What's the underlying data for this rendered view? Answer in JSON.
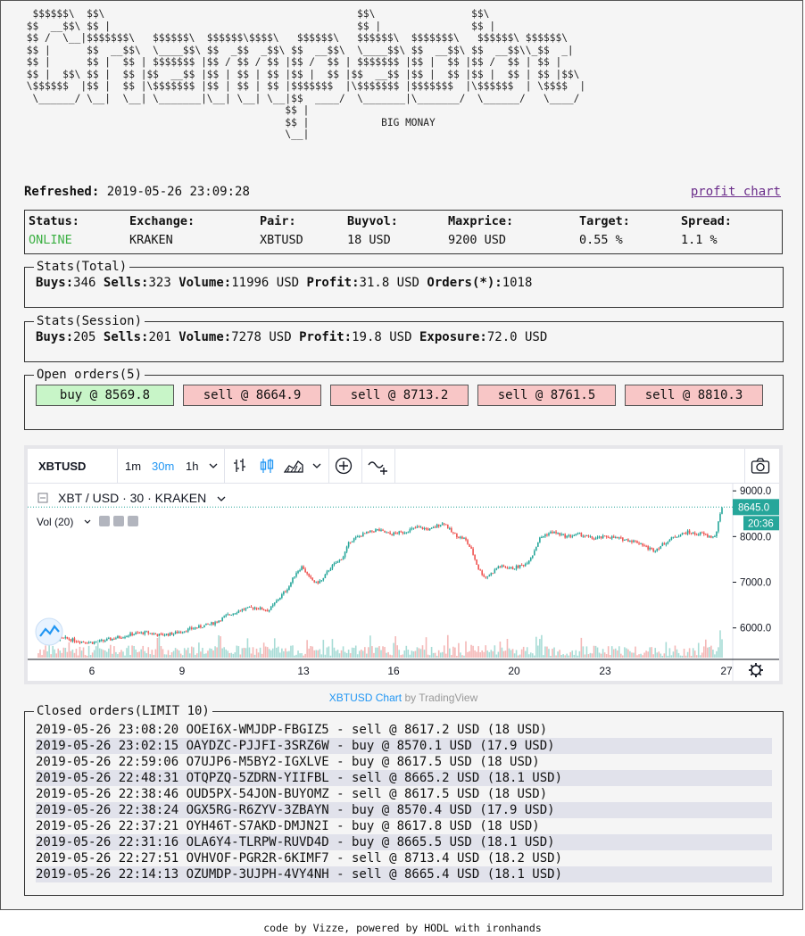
{
  "ascii_logo": "  $$$$$$\\  $$\\                                          $$\\                $$\\\n $$  __$$\\ $$ |                                         $$ |               $$ |\n $$ /  \\__|$$$$$$$\\   $$$$$$\\  $$$$$$\\$$$$\\   $$$$$$\\   $$$$$$\\  $$$$$$$\\   $$$$$$\\ $$$$$$\\\n $$ |      $$  __$$\\  \\____$$\\ $$  _$$  _$$\\ $$  __$$\\  \\____$$\\ $$  __$$\\ $$  __$$\\\\_$$  _|\n $$ |      $$ |  $$ | $$$$$$$ |$$ / $$ / $$ |$$ /  $$ | $$$$$$$ |$$ |  $$ |$$ /  $$ | $$ |\n $$ |  $$\\ $$ |  $$ |$$  __$$ |$$ | $$ | $$ |$$ |  $$ |$$  __$$ |$$ |  $$ |$$ |  $$ | $$ |$$\\\n \\$$$$$$  |$$ |  $$ |\\$$$$$$$ |$$ | $$ | $$ |$$$$$$$  |\\$$$$$$$ |$$$$$$$  |\\$$$$$$  | \\$$$$  |\n  \\______/ \\__|  \\__| \\_______|\\__| \\__| \\__|$$  ____/  \\_______|\\_______/  \\______/   \\____/\n                                            $$ |\n                                            $$ |            BIG MONAY\n                                            \\__|",
  "refreshed": {
    "label": "Refreshed:",
    "value": "2019-05-26 23:09:28"
  },
  "profit_chart_link": "profit chart",
  "status": {
    "columns": [
      {
        "label": "Status:",
        "value": "ONLINE"
      },
      {
        "label": "Exchange:",
        "value": "KRAKEN"
      },
      {
        "label": "Pair:",
        "value": "XBTUSD"
      },
      {
        "label": "Buyvol:",
        "value": "18 USD"
      },
      {
        "label": "Maxprice:",
        "value": "9200 USD"
      },
      {
        "label": "Target:",
        "value": "0.55 %"
      },
      {
        "label": "Spread:",
        "value": "1.1 %"
      }
    ]
  },
  "stats_total": {
    "legend": "Stats(Total)",
    "buys_label": "Buys:",
    "buys": "346",
    "sells_label": "Sells:",
    "sells": "323",
    "volume_label": "Volume:",
    "volume": "11996 USD",
    "profit_label": "Profit:",
    "profit": "31.8 USD",
    "orders_label": "Orders(*):",
    "orders": "1018"
  },
  "stats_session": {
    "legend": "Stats(Session)",
    "buys_label": "Buys:",
    "buys": "205",
    "sells_label": "Sells:",
    "sells": "201",
    "volume_label": "Volume:",
    "volume": "7278 USD",
    "profit_label": "Profit:",
    "profit": "19.8 USD",
    "exposure_label": "Exposure:",
    "exposure": "72.0 USD"
  },
  "open_orders": {
    "legend": "Open orders(5)",
    "items": [
      {
        "side": "buy",
        "label": "buy @ 8569.8"
      },
      {
        "side": "sell",
        "label": "sell @ 8664.9"
      },
      {
        "side": "sell",
        "label": "sell @ 8713.2"
      },
      {
        "side": "sell",
        "label": "sell @ 8761.5"
      },
      {
        "side": "sell",
        "label": "sell @ 8810.3"
      }
    ]
  },
  "tradingview": {
    "symbol": "XBTUSD",
    "timeframes": [
      "1m",
      "30m",
      "1h"
    ],
    "active_timeframe": "30m",
    "legend_pair": "XBT / USD",
    "legend_interval": "30",
    "legend_exchange": "KRAKEN",
    "volume_label": "Vol (20)",
    "price_tag": "8645.0",
    "countdown": "20:36",
    "accent_color": "#26a69a",
    "down_color": "#ef5350",
    "icons": [
      "candles-icon",
      "chevron-down-icon",
      "bars-icon",
      "candlestick-icon",
      "area-icon",
      "add-indicator-icon",
      "compare-icon",
      "camera-icon",
      "settings-icon",
      "tradingview-logo-icon"
    ]
  },
  "chart_data": {
    "type": "candlestick",
    "series": [
      {
        "name": "XBT / USD · 30 · KRAKEN"
      }
    ],
    "x_ticks": [
      "6",
      "9",
      "13",
      "16",
      "20",
      "23",
      "27"
    ],
    "y_ticks": [
      "6000.0",
      "7000.0",
      "8000.0",
      "9000.0"
    ],
    "ylim": [
      5350,
      9100
    ],
    "close_points": [
      [
        0,
        5760
      ],
      [
        2,
        5740
      ],
      [
        4,
        5770
      ],
      [
        6,
        5710
      ],
      [
        8,
        5680
      ],
      [
        10,
        5730
      ],
      [
        12,
        5800
      ],
      [
        14,
        5870
      ],
      [
        16,
        5900
      ],
      [
        18,
        5840
      ],
      [
        20,
        5880
      ],
      [
        22,
        5960
      ],
      [
        24,
        6030
      ],
      [
        26,
        6110
      ],
      [
        28,
        6280
      ],
      [
        30,
        6400
      ],
      [
        32,
        6450
      ],
      [
        34,
        6380
      ],
      [
        35,
        6550
      ],
      [
        37,
        6900
      ],
      [
        38,
        7200
      ],
      [
        39,
        7350
      ],
      [
        40,
        7100
      ],
      [
        41,
        6980
      ],
      [
        42,
        7050
      ],
      [
        43,
        7300
      ],
      [
        45,
        7550
      ],
      [
        46,
        7900
      ],
      [
        48,
        8050
      ],
      [
        50,
        8150
      ],
      [
        52,
        8050
      ],
      [
        54,
        8100
      ],
      [
        56,
        8200
      ],
      [
        58,
        8150
      ],
      [
        59,
        8250
      ],
      [
        60,
        8300
      ],
      [
        61,
        8100
      ],
      [
        62,
        8000
      ],
      [
        63,
        7950
      ],
      [
        64,
        7700
      ],
      [
        65,
        7300
      ],
      [
        66,
        7100
      ],
      [
        67,
        7200
      ],
      [
        68,
        7350
      ],
      [
        70,
        7300
      ],
      [
        72,
        7400
      ],
      [
        73,
        7600
      ],
      [
        74,
        7950
      ],
      [
        75,
        8050
      ],
      [
        76,
        8100
      ],
      [
        78,
        8000
      ],
      [
        80,
        8050
      ],
      [
        82,
        7950
      ],
      [
        84,
        8000
      ],
      [
        86,
        7950
      ],
      [
        88,
        7900
      ],
      [
        89,
        7850
      ],
      [
        90,
        7750
      ],
      [
        91,
        7700
      ],
      [
        92,
        7800
      ],
      [
        93,
        7900
      ],
      [
        94,
        8000
      ],
      [
        95,
        8050
      ],
      [
        96,
        8100
      ],
      [
        97,
        8050
      ],
      [
        98,
        8070
      ],
      [
        99,
        8000
      ],
      [
        100,
        7990
      ],
      [
        101,
        8650
      ]
    ]
  },
  "chart_caption": {
    "link": "XBTUSD Chart",
    "by": "by TradingView"
  },
  "closed_orders": {
    "legend": "Closed orders(LIMIT 10)",
    "items": [
      "2019-05-26 23:08:20 OOEI6X-WMJDP-FBGIZ5 - sell @ 8617.2 USD (18 USD)",
      "2019-05-26 23:02:15 OAYDZC-PJJFI-3SRZ6W - buy @ 8570.1 USD (17.9 USD)",
      "2019-05-26 22:59:06 O7UJP6-M5BY2-IGXLVE - buy @ 8617.5 USD (18 USD)",
      "2019-05-26 22:48:31 OTQPZQ-5ZDRN-YIIFBL - sell @ 8665.2 USD (18.1 USD)",
      "2019-05-26 22:38:46 OUD5PX-54JON-BUYOMZ - sell @ 8617.5 USD (18 USD)",
      "2019-05-26 22:38:24 OGX5RG-R6ZYV-3ZBAYN - buy @ 8570.4 USD (17.9 USD)",
      "2019-05-26 22:37:21 OYH46T-S7AKD-DMJN2I - buy @ 8617.8 USD (18 USD)",
      "2019-05-26 22:31:16 OLA6Y4-TLRPW-RUVD4D - buy @ 8665.5 USD (18.1 USD)",
      "2019-05-26 22:27:51 OVHVOF-PGR2R-6KIMF7 - sell @ 8713.4 USD (18.2 USD)",
      "2019-05-26 22:14:13 OZUMDP-3UJPH-4VY4NH - sell @ 8665.4 USD (18.1 USD)"
    ]
  },
  "footer": "code by Vizze, powered by HODL with ironhands"
}
